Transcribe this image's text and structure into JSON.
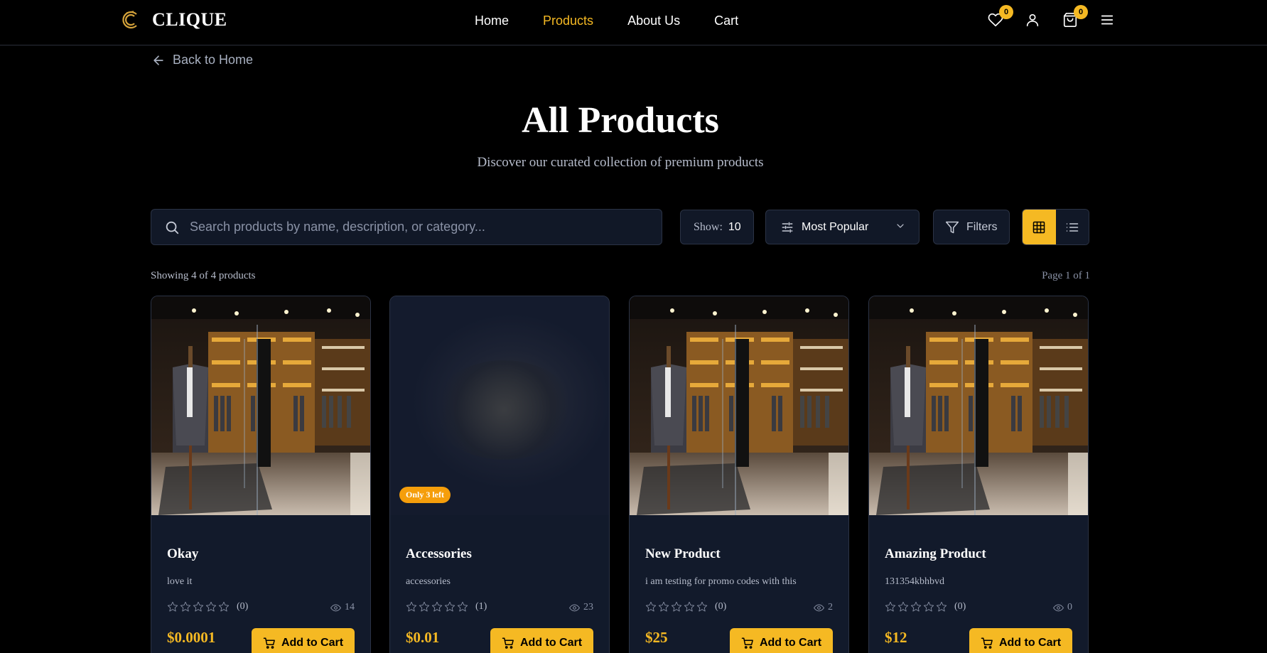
{
  "header": {
    "brand": "CLIQUE",
    "nav": [
      {
        "label": "Home",
        "active": false
      },
      {
        "label": "Products",
        "active": true
      },
      {
        "label": "About Us",
        "active": false
      },
      {
        "label": "Cart",
        "active": false
      }
    ],
    "wishlist_count": "0",
    "cart_count": "0",
    "icons": [
      "heart-icon",
      "user-icon",
      "shopping-bag-icon",
      "menu-icon"
    ]
  },
  "back_link": "Back to Home",
  "hero": {
    "title": "All Products",
    "subtitle": "Discover our curated collection of premium products"
  },
  "toolbar": {
    "search_placeholder": "Search products by name, description, or category...",
    "show_label": "Show:",
    "show_value": "10",
    "sort_value": "Most Popular",
    "filters_label": "Filters",
    "view_mode": "grid"
  },
  "results": {
    "showing": "Showing 4 of 4 products",
    "page": "Page 1 of 1"
  },
  "products": [
    {
      "name": "Okay",
      "description": "love it",
      "rating_count": "(0)",
      "views": "14",
      "price": "$0.0001",
      "add_label": "Add to Cart",
      "badge": "",
      "image": "store-interior"
    },
    {
      "name": "Accessories",
      "description": "accessories",
      "rating_count": "(1)",
      "views": "23",
      "price": "$0.01",
      "add_label": "Add to Cart",
      "badge": "Only 3 left",
      "image": "smoke-cloud"
    },
    {
      "name": "New Product",
      "description": "i am testing for promo codes with this",
      "rating_count": "(0)",
      "views": "2",
      "price": "$25",
      "add_label": "Add to Cart",
      "badge": "",
      "image": "store-interior"
    },
    {
      "name": "Amazing Product",
      "description": "131354kbhbvd",
      "rating_count": "(0)",
      "views": "0",
      "price": "$12",
      "add_label": "Add to Cart",
      "badge": "",
      "image": "store-interior"
    }
  ],
  "colors": {
    "accent": "#f5b923",
    "background": "#000000",
    "card": "#121a2b"
  }
}
